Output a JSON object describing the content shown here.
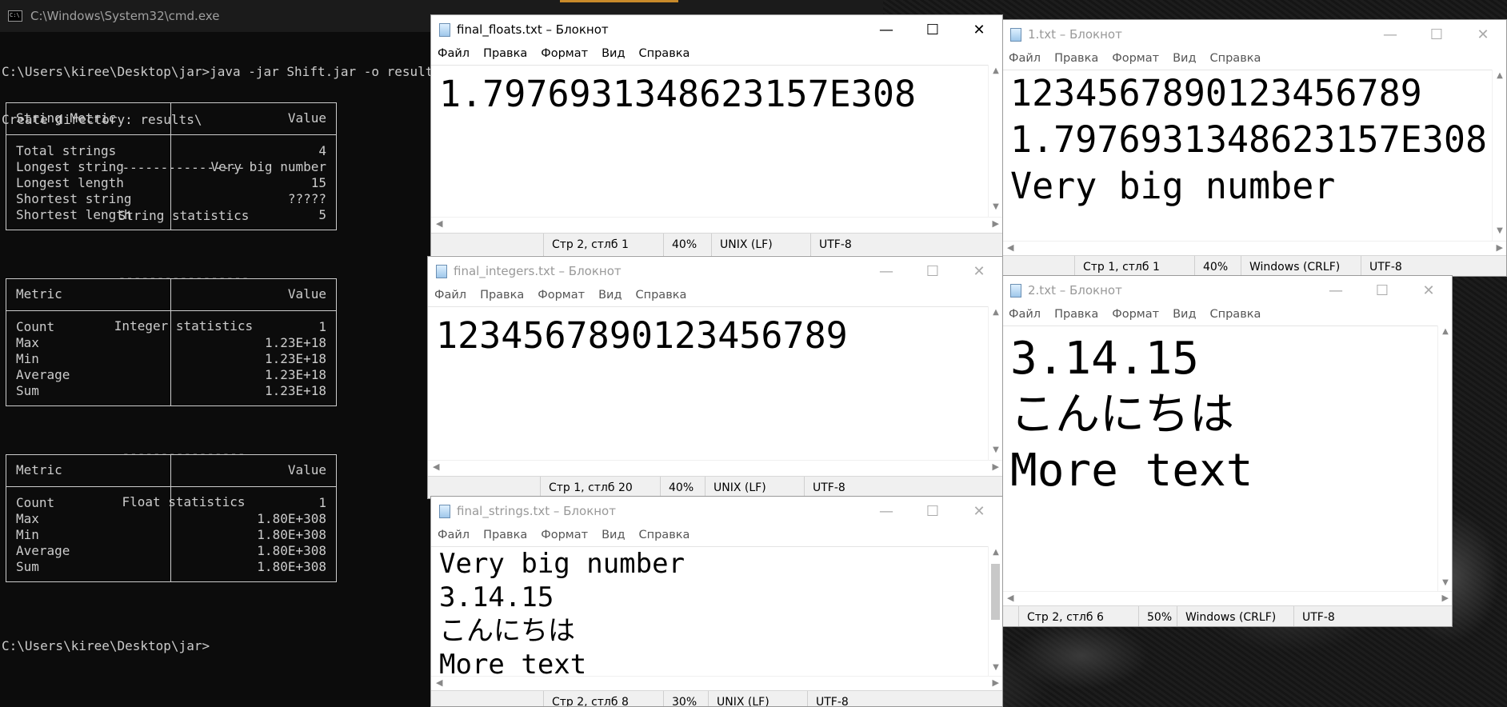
{
  "cmd": {
    "title": "C:\\Windows\\System32\\cmd.exe",
    "command_line": "C:\\Users\\kiree\\Desktop\\jar>java -jar Shift.jar -o results -p",
    "create_dir": "Create directory: results\\",
    "prompt": "C:\\Users\\kiree\\Desktop\\jar>",
    "strings": {
      "rule": "----------------",
      "heading": "String statistics",
      "col_metric": "String Metric",
      "col_value": "Value",
      "rows": [
        {
          "metric": "Total strings",
          "value": "4"
        },
        {
          "metric": "Longest string",
          "value": "Very big number"
        },
        {
          "metric": "Longest length",
          "value": "15"
        },
        {
          "metric": "Shortest string",
          "value": "?????"
        },
        {
          "metric": "Shortest length",
          "value": "5"
        }
      ]
    },
    "integers": {
      "rule": "-----------------",
      "heading": "Integer statistics",
      "col_metric": "Metric",
      "col_value": "Value",
      "rows": [
        {
          "metric": "Count",
          "value": "1"
        },
        {
          "metric": "Max",
          "value": "1.23E+18"
        },
        {
          "metric": "Min",
          "value": "1.23E+18"
        },
        {
          "metric": "Average",
          "value": "1.23E+18"
        },
        {
          "metric": "Sum",
          "value": "1.23E+18"
        }
      ]
    },
    "floats": {
      "rule": "----------------",
      "heading": "Float statistics",
      "col_metric": "Metric",
      "col_value": "Value",
      "rows": [
        {
          "metric": "Count",
          "value": "1"
        },
        {
          "metric": "Max",
          "value": "1.80E+308"
        },
        {
          "metric": "Min",
          "value": "1.80E+308"
        },
        {
          "metric": "Average",
          "value": "1.80E+308"
        },
        {
          "metric": "Sum",
          "value": "1.80E+308"
        }
      ]
    }
  },
  "menu": [
    "Файл",
    "Правка",
    "Формат",
    "Вид",
    "Справка"
  ],
  "windows": {
    "floats": {
      "title": "final_floats.txt – Блокнот",
      "lines": [
        "1.7976931348623157E308"
      ],
      "status": {
        "pos": "Стр 2, стлб 1",
        "zoom": "40%",
        "eol": "UNIX (LF)",
        "enc": "UTF-8"
      }
    },
    "integers": {
      "title": "final_integers.txt – Блокнот",
      "lines": [
        "1234567890123456789"
      ],
      "status": {
        "pos": "Стр 1, стлб 20",
        "zoom": "40%",
        "eol": "UNIX (LF)",
        "enc": "UTF-8"
      }
    },
    "strings": {
      "title": "final_strings.txt – Блокнот",
      "lines": [
        "Very big number",
        "3.14.15",
        "こんにちは",
        "More text"
      ],
      "status": {
        "pos": "Стр 2, стлб 8",
        "zoom": "30%",
        "eol": "UNIX (LF)",
        "enc": "UTF-8"
      }
    },
    "one": {
      "title": "1.txt – Блокнот",
      "lines": [
        "1234567890123456789",
        "1.7976931348623157E308",
        "Very big number"
      ],
      "status": {
        "pos": "Стр 1, стлб 1",
        "zoom": "40%",
        "eol": "Windows (CRLF)",
        "enc": "UTF-8"
      }
    },
    "two": {
      "title": "2.txt – Блокнот",
      "lines": [
        "3.14.15",
        "こんにちは",
        "More text"
      ],
      "status": {
        "pos": "Стр 2, стлб 6",
        "zoom": "50%",
        "eol": "Windows (CRLF)",
        "enc": "UTF-8"
      }
    }
  },
  "icons": {
    "minimize": "minimize-icon",
    "maximize": "maximize-icon",
    "close": "close-icon"
  }
}
